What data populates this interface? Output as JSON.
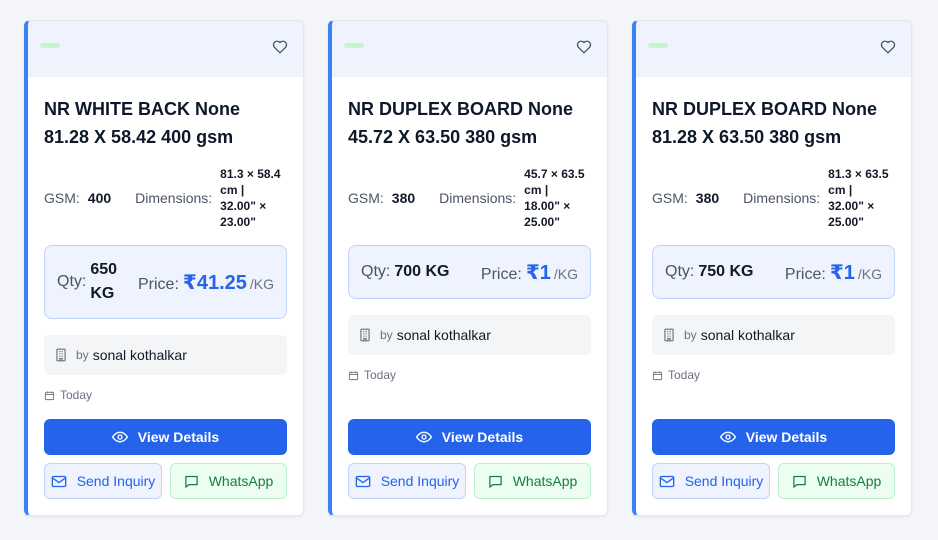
{
  "cards": [
    {
      "title": "NR WHITE BACK None 81.28 X 58.42 400 gsm",
      "gsm_label": "GSM:",
      "gsm": "400",
      "dimensions_label": "Dimensions:",
      "dimensions": "81.3 × 58.4 cm | 32.00\" × 23.00\"",
      "qty_label": "Qty:",
      "qty": "650 KG",
      "price_label": "Price:",
      "price": "₹41.25",
      "price_unit": "/KG",
      "by_label": "by",
      "seller": "sonal kothalkar",
      "date": "Today",
      "view_label": "View Details",
      "inquiry_label": "Send Inquiry",
      "whatsapp_label": "WhatsApp"
    },
    {
      "title": "NR DUPLEX BOARD None 45.72 X 63.50 380 gsm",
      "gsm_label": "GSM:",
      "gsm": "380",
      "dimensions_label": "Dimensions:",
      "dimensions": "45.7 × 63.5 cm | 18.00\" × 25.00\"",
      "qty_label": "Qty:",
      "qty": "700 KG",
      "price_label": "Price:",
      "price": "₹1",
      "price_unit": "/KG",
      "by_label": "by",
      "seller": "sonal kothalkar",
      "date": "Today",
      "view_label": "View Details",
      "inquiry_label": "Send Inquiry",
      "whatsapp_label": "WhatsApp"
    },
    {
      "title": "NR DUPLEX BOARD None 81.28 X 63.50 380 gsm",
      "gsm_label": "GSM:",
      "gsm": "380",
      "dimensions_label": "Dimensions:",
      "dimensions": "81.3 × 63.5 cm | 32.00\" × 25.00\"",
      "qty_label": "Qty:",
      "qty": "750 KG",
      "price_label": "Price:",
      "price": "₹1",
      "price_unit": "/KG",
      "by_label": "by",
      "seller": "sonal kothalkar",
      "date": "Today",
      "view_label": "View Details",
      "inquiry_label": "Send Inquiry",
      "whatsapp_label": "WhatsApp"
    }
  ],
  "icons": {
    "favorite": "heart-icon",
    "seller": "building-icon",
    "date": "calendar-icon",
    "view": "eye-icon",
    "inquiry": "mail-icon",
    "whatsapp": "message-icon"
  },
  "colors": {
    "accent": "#2563eb",
    "card_border_accent": "#3b82f6",
    "whatsapp": "#15803d",
    "status_pill": "#c8f2d0"
  }
}
